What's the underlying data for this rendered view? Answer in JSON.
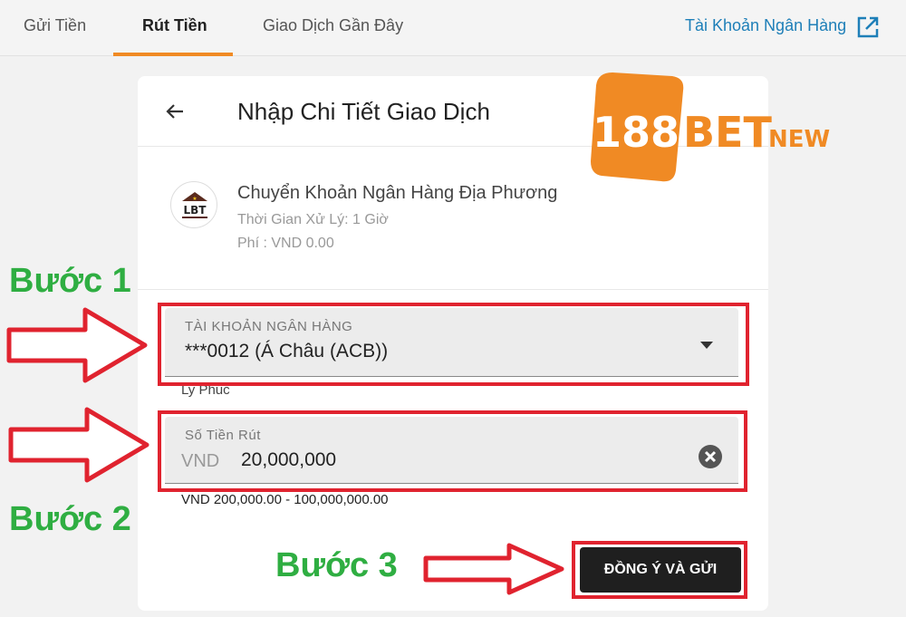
{
  "tabs": [
    {
      "label": "Gửi Tiền",
      "active": false
    },
    {
      "label": "Rút Tiền",
      "active": true
    },
    {
      "label": "Giao Dịch Gần Đây",
      "active": false
    }
  ],
  "bank_link": "Tài Khoản Ngân Hàng",
  "card": {
    "title": "Nhập Chi Tiết Giao Dịch",
    "method": {
      "logo_text": "LBT",
      "name": "Chuyển Khoản Ngân Hàng Địa Phương",
      "processing_time": "Thời Gian Xử Lý: 1 Giờ",
      "fee": "Phí : VND 0.00"
    },
    "account_field": {
      "label": "TÀI KHOẢN NGÂN HÀNG",
      "value": "***0012 (Á Châu (ACB))"
    },
    "account_holder": "Ly Phúc",
    "amount_field": {
      "label": "Số Tiền Rút",
      "currency": "VND",
      "value": "20,000,000"
    },
    "amount_range": "VND 200,000.00 - 100,000,000.00",
    "submit_label": "ĐỒNG Ý VÀ GỬI"
  },
  "brand": {
    "number": "188",
    "bet": "BET",
    "suffix": "NEW"
  },
  "annotations": {
    "step1": "Bước 1",
    "step2": "Bước 2",
    "step3": "Bước 3"
  },
  "colors": {
    "accent_orange": "#f08a24",
    "link_blue": "#1e7fb8",
    "highlight_red": "#e0232f",
    "step_green": "#2fae42",
    "button_dark": "#1f1f1f"
  }
}
